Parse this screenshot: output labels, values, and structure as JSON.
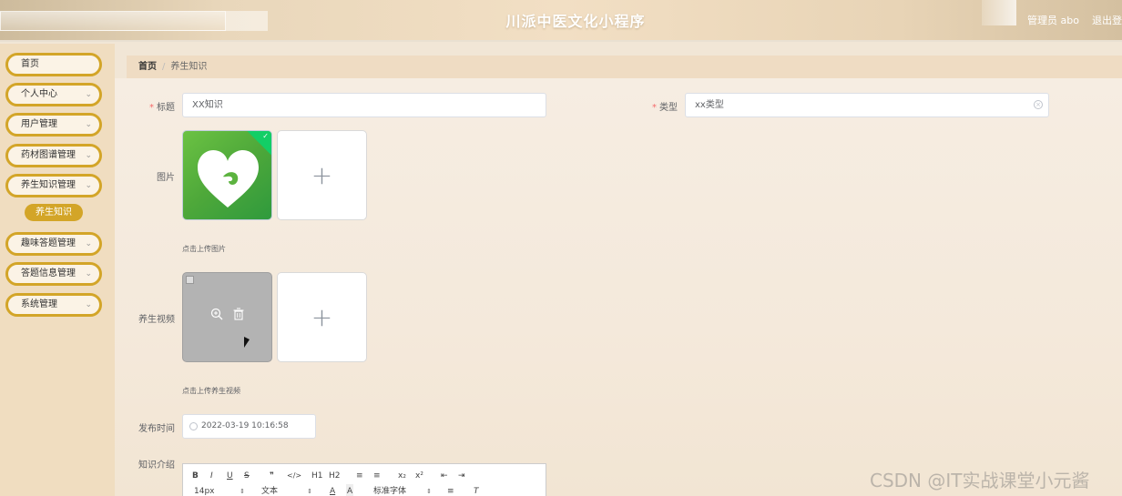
{
  "header": {
    "title": "川派中医文化小程序",
    "user_label": "管理员 abo",
    "logout_label": "退出登录"
  },
  "sidebar": {
    "items": [
      {
        "label": "首页",
        "has_arrow": false
      },
      {
        "label": "个人中心",
        "has_arrow": true
      },
      {
        "label": "用户管理",
        "has_arrow": true
      },
      {
        "label": "药材图谱管理",
        "has_arrow": true
      },
      {
        "label": "养生知识管理",
        "has_arrow": true
      },
      {
        "label": "趣味答题管理",
        "has_arrow": true
      },
      {
        "label": "答题信息管理",
        "has_arrow": true
      },
      {
        "label": "系统管理",
        "has_arrow": true
      }
    ],
    "active_sub_item": "养生知识"
  },
  "breadcrumb": {
    "home": "首页",
    "separator": "/",
    "current": "养生知识"
  },
  "form": {
    "title_label": "标题",
    "title_value": "XX知识",
    "type_label": "类型",
    "type_value": "xx类型",
    "image_label": "图片",
    "image_hint": "点击上传图片",
    "video_label": "养生视频",
    "video_hint": "点击上传养生视频",
    "date_label": "发布时间",
    "date_value": "2022-03-19 10:16:58",
    "intro_label": "知识介绍",
    "upload_plus": "+"
  },
  "editor": {
    "toolbar_row1": [
      "B",
      "I",
      "U",
      "S",
      "❞",
      "</>",
      "H1",
      "H2",
      "≡",
      "≡",
      "x₂",
      "x²",
      "⇤",
      "⇥"
    ],
    "font_size": "14px",
    "text_style": "文本",
    "font_family": "标准字体"
  },
  "watermark": "CSDN @IT实战课堂小元酱",
  "colors": {
    "accent_gold": "#d3a528",
    "required_red": "#f56c6c",
    "success_green": "#13ce66"
  }
}
